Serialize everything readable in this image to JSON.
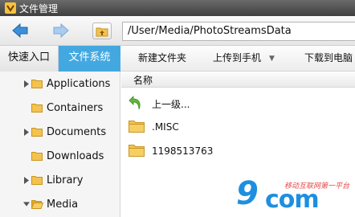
{
  "window": {
    "title": "文件管理"
  },
  "navigation": {
    "back_icon": "arrow-left-icon",
    "forward_icon": "arrow-right-icon",
    "up_icon": "folder-up-icon",
    "path": "/User/Media/PhotoStreamsData"
  },
  "tabs": {
    "quick_access": "快速入口",
    "file_system": "文件系统"
  },
  "toolbar": {
    "new_folder": "新建文件夹",
    "upload": "上传到手机",
    "download": "下载到电脑"
  },
  "sidebar": {
    "items": [
      {
        "label": "Applications",
        "expandable": true
      },
      {
        "label": "Containers",
        "expandable": false
      },
      {
        "label": "Documents",
        "expandable": true
      },
      {
        "label": "Downloads",
        "expandable": false
      },
      {
        "label": "Library",
        "expandable": true
      },
      {
        "label": "Media",
        "expanded": true
      }
    ]
  },
  "file_list": {
    "column_name": "名称",
    "rows": [
      {
        "label": "上一级...",
        "icon": "back-up-icon"
      },
      {
        "label": ".MISC",
        "icon": "folder-icon"
      },
      {
        "label": "1198513763",
        "icon": "folder-icon"
      }
    ]
  },
  "watermark": {
    "logo_nine": "9",
    "logo_com": "com",
    "slogan": "移动互联网第一平台"
  },
  "colors": {
    "accent_tab": "#44a8e0",
    "folder": "#f3c24f",
    "watermark_blue": "#1e8fe0",
    "watermark_red": "#e54848"
  }
}
